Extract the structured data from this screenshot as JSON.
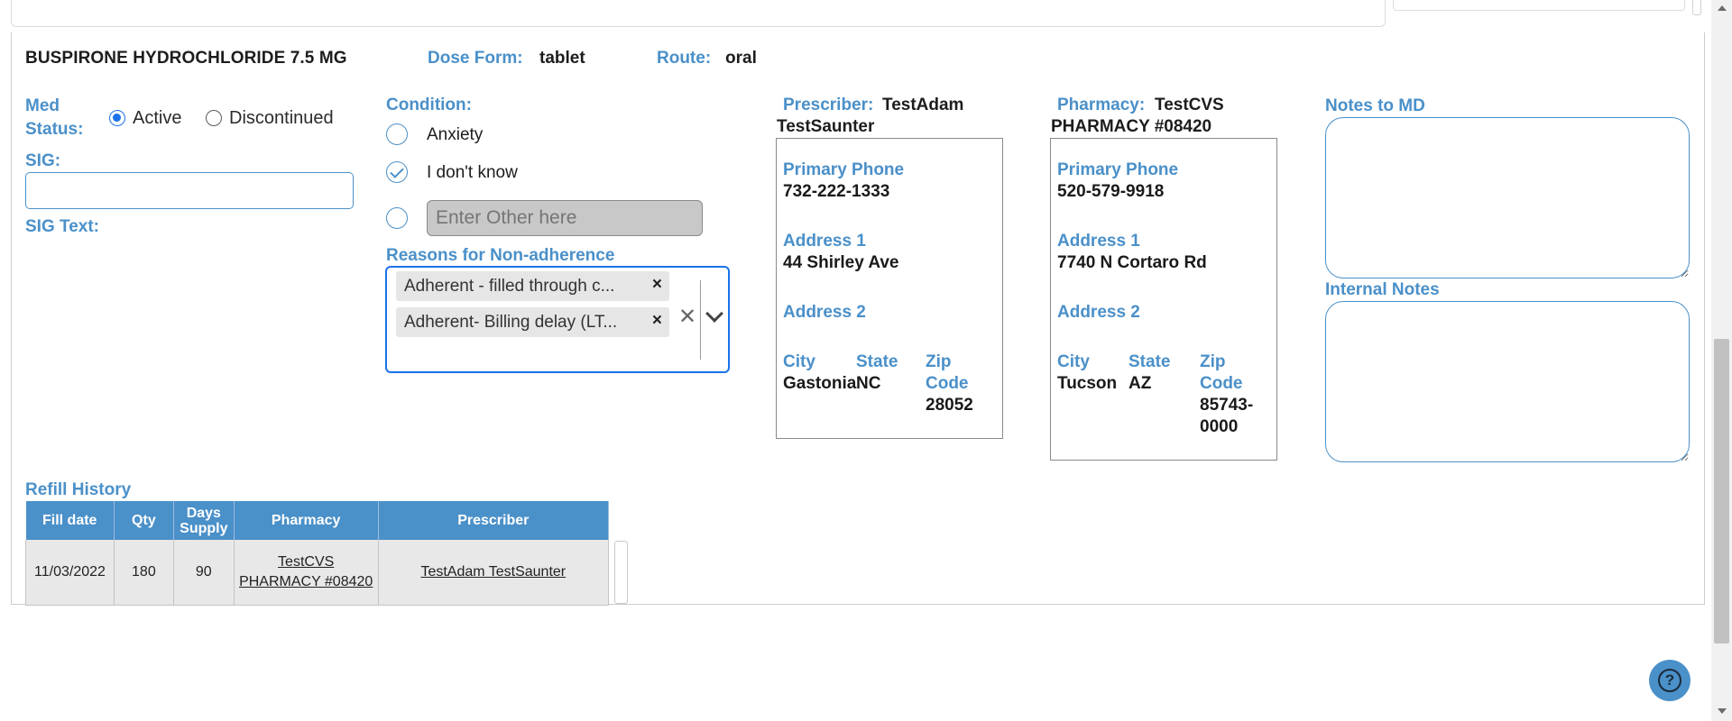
{
  "progress": {
    "fraction": 0.628
  },
  "drug": {
    "name": "BUSPIRONE HYDROCHLORIDE 7.5 MG",
    "dose_form_label": "Dose Form:",
    "dose_form": "tablet",
    "route_label": "Route:",
    "route": "oral"
  },
  "med_status": {
    "label_line1": "Med",
    "label_line2": "Status:",
    "options": [
      "Active",
      "Discontinued"
    ],
    "selected": "Active"
  },
  "sig": {
    "label": "SIG:",
    "value": "",
    "text_label": "SIG Text:"
  },
  "condition": {
    "label": "Condition:",
    "options": [
      {
        "label": "Anxiety",
        "checked": false
      },
      {
        "label": "I don't know",
        "checked": true
      }
    ],
    "other_placeholder": "Enter Other here"
  },
  "non_adherence": {
    "label": "Reasons for Non-adherence",
    "chips": [
      "Adherent - filled through c...",
      "Adherent- Billing delay (LT..."
    ],
    "chip_remove": "×",
    "clear_all": "✕"
  },
  "prescriber": {
    "label": "Prescriber:",
    "name_line1": "TestAdam",
    "name_line2": "TestSaunter",
    "primary_phone_label": "Primary Phone",
    "primary_phone": "732-222-1333",
    "address1_label": "Address 1",
    "address1": "44 Shirley Ave",
    "address2_label": "Address 2",
    "address2": "",
    "city_label": "City",
    "state_label": "State",
    "zip_label_line1": "Zip",
    "zip_label_line2": "Code",
    "city": "Gastonia",
    "state": "NC",
    "zip_line1": "28052",
    "zip_line2": ""
  },
  "pharmacy": {
    "label": "Pharmacy:",
    "name_line1": "TestCVS",
    "name_line2": "PHARMACY #08420",
    "primary_phone_label": "Primary Phone",
    "primary_phone": "520-579-9918",
    "address1_label": "Address 1",
    "address1": "7740 N Cortaro Rd",
    "address2_label": "Address 2",
    "address2": "",
    "city_label": "City",
    "state_label": "State",
    "zip_label_line1": "Zip",
    "zip_label_line2": "Code",
    "city": "Tucson",
    "state": "AZ",
    "zip_line1": "85743-",
    "zip_line2": "0000"
  },
  "notes": {
    "md_label": "Notes to MD",
    "md_value": "",
    "internal_label": "Internal Notes",
    "internal_value": ""
  },
  "refill_history": {
    "label": "Refill History",
    "headers": [
      "Fill date",
      "Qty",
      "Days Supply",
      "Pharmacy",
      "Prescriber"
    ],
    "rows": [
      {
        "fill_date": "11/03/2022",
        "qty": "180",
        "days_supply": "90",
        "pharmacy": "TestCVS PHARMACY #08420",
        "prescriber": "TestAdam TestSaunter"
      }
    ]
  },
  "help": {
    "icon": "?"
  },
  "colors": {
    "accent": "#4a90c9",
    "focus": "#1a73e8"
  }
}
